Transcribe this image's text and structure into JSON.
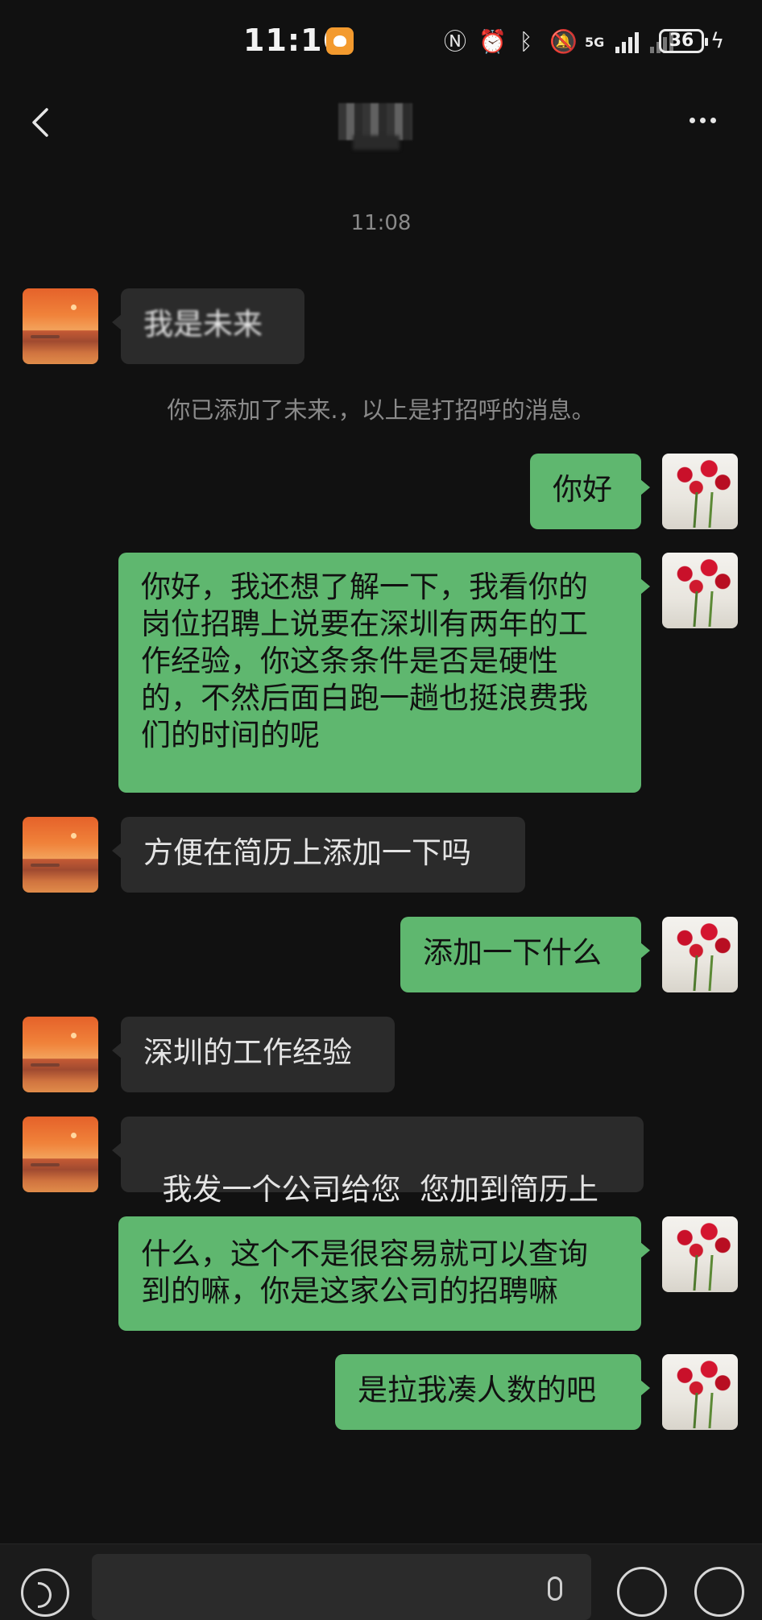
{
  "status_bar": {
    "time": "11:16",
    "network": "5G",
    "battery": "36"
  },
  "header": {
    "title": ""
  },
  "conversation": {
    "timestamp": "11:08",
    "system_notice": "你已添加了未来.，以上是打招呼的消息。",
    "messages": [
      {
        "direction": "in",
        "text": "我是未来"
      },
      {
        "direction": "out",
        "text": "你好"
      },
      {
        "direction": "out",
        "lines": [
          "你好，我还想了解一下，我看你的",
          "岗位招聘上说要在深圳有两年的工",
          "作经验，你这条条件是否是硬性",
          "的，不然后面白跑一趟也挺浪费我",
          "们的时间的呢"
        ]
      },
      {
        "direction": "in",
        "text": "方便在简历上添加一下吗"
      },
      {
        "direction": "out",
        "text": "添加一下什么"
      },
      {
        "direction": "in",
        "text": "深圳的工作经验"
      },
      {
        "direction": "in",
        "text": "我发一个公司给您  您加到简历上"
      },
      {
        "direction": "out",
        "lines": [
          "什么，这个不是很容易就可以查询",
          "到的嘛，你是这家公司的招聘嘛"
        ]
      },
      {
        "direction": "out",
        "text": "是拉我凑人数的吧"
      }
    ]
  },
  "input_bar": {
    "placeholder": ""
  },
  "colors": {
    "background": "#111111",
    "incoming_bubble": "#2b2b2b",
    "outgoing_bubble": "#5fb76f"
  }
}
